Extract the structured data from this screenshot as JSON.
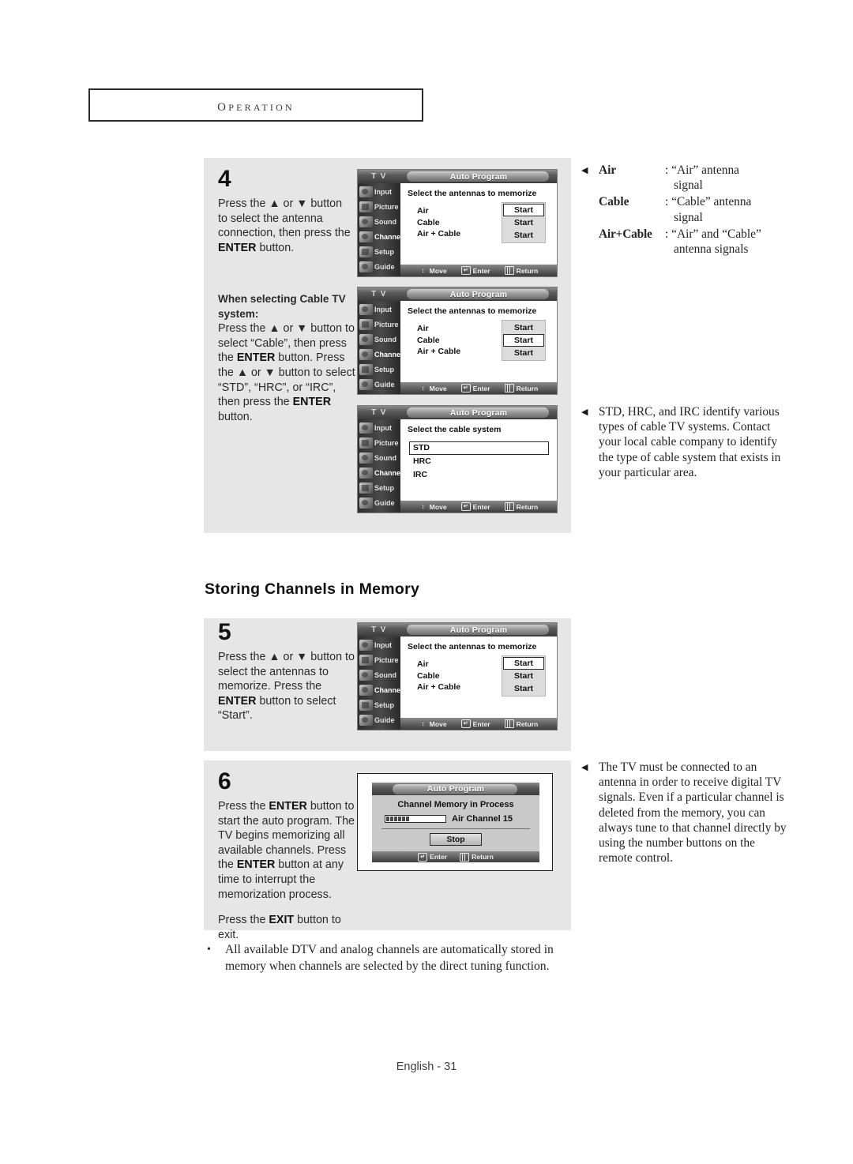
{
  "header": {
    "title": "Operation"
  },
  "footer": {
    "text": "English - 31"
  },
  "section_heading": "Storing Channels in Memory",
  "steps": {
    "step4": {
      "number": "4",
      "text_1": "Press the ",
      "arrow_up": "▲",
      "text_2": " or ",
      "arrow_down": "▼",
      "text_3": " button to select the antenna connection, then press the ",
      "enter_label": "ENTER",
      "text_4": " button.",
      "cable_heading": "When selecting Cable TV system:",
      "cable_line1": "Press the ▲ or ▼ button to select “Cable”, then press the ",
      "cable_enter1": "ENTER",
      "cable_line2": " button. Press the ▲ or ▼ button to select “STD”, “HRC”, or “IRC”, then press the ",
      "cable_enter2": "ENTER",
      "cable_line3": " button."
    },
    "step5": {
      "number": "5",
      "line1": "Press the ▲ or ▼ button to select the antennas to memorize. Press the ",
      "enter_label": "ENTER",
      "line2": " button to select “Start”."
    },
    "step6": {
      "number": "6",
      "seg1": "Press the ",
      "enter1": "ENTER",
      "seg2": " button to start the auto program. The TV begins memorizing all available channels. Press the ",
      "enter2": "ENTER",
      "seg3": " button at any time to interrupt the memorization process.",
      "exit_seg1": "Press the ",
      "exit_label": "EXIT",
      "exit_seg2": " button to exit."
    }
  },
  "notes": {
    "air": {
      "marker": "◀",
      "rows": [
        {
          "term": "Air",
          "desc": ": “Air” antenna",
          "desc2": "signal"
        },
        {
          "term": "Cable",
          "desc": ": “Cable” antenna",
          "desc2": "signal"
        },
        {
          "term": "Air+Cable",
          "desc": ": “Air” and “Cable”",
          "desc2": "antenna signals"
        }
      ]
    },
    "std": {
      "marker": "◀",
      "text": "STD, HRC, and IRC identify various types of cable TV systems. Contact your local cable company to identify the type of cable system that exists in your particular area."
    },
    "tv_antenna": {
      "marker": "◀",
      "text": "The TV must be connected to an antenna in order to receive digital TV signals. Even if a particular channel is deleted from the memory, you can always tune to that channel directly by using the number buttons on the remote control."
    }
  },
  "bullet": {
    "dot": "•",
    "text": "All available DTV and analog channels are automatically stored in memory when channels are selected by the direct tuning function."
  },
  "osd": {
    "brand": "T V",
    "title": "Auto Program",
    "sidebar": [
      {
        "label": "Input",
        "icon": "input-icon"
      },
      {
        "label": "Picture",
        "icon": "picture-icon"
      },
      {
        "label": "Sound",
        "icon": "sound-icon"
      },
      {
        "label": "Channel",
        "icon": "channel-icon"
      },
      {
        "label": "Setup",
        "icon": "setup-icon"
      },
      {
        "label": "Guide",
        "icon": "guide-icon"
      }
    ],
    "hints": {
      "move": "Move",
      "enter": "Enter",
      "return": "Return"
    },
    "antenna_screen": {
      "prompt": "Select the antennas to memorize",
      "options": [
        "Air",
        "Cable",
        "Air + Cable"
      ],
      "start_label": "Start",
      "selected_index_screen1": 0,
      "selected_index_screen2": 1,
      "selected_index_screen5": 0
    },
    "cable_screen": {
      "prompt": "Select the cable system",
      "options": [
        "STD",
        "HRC",
        "IRC"
      ],
      "selected_index": 0
    },
    "progress_dialog": {
      "title": "Auto Program",
      "heading": "Channel Memory in Process",
      "channel_label": "Air Channel 15",
      "progress_segments_filled": 6,
      "stop_label": "Stop",
      "hint_enter": "Enter",
      "hint_return": "Return"
    }
  }
}
